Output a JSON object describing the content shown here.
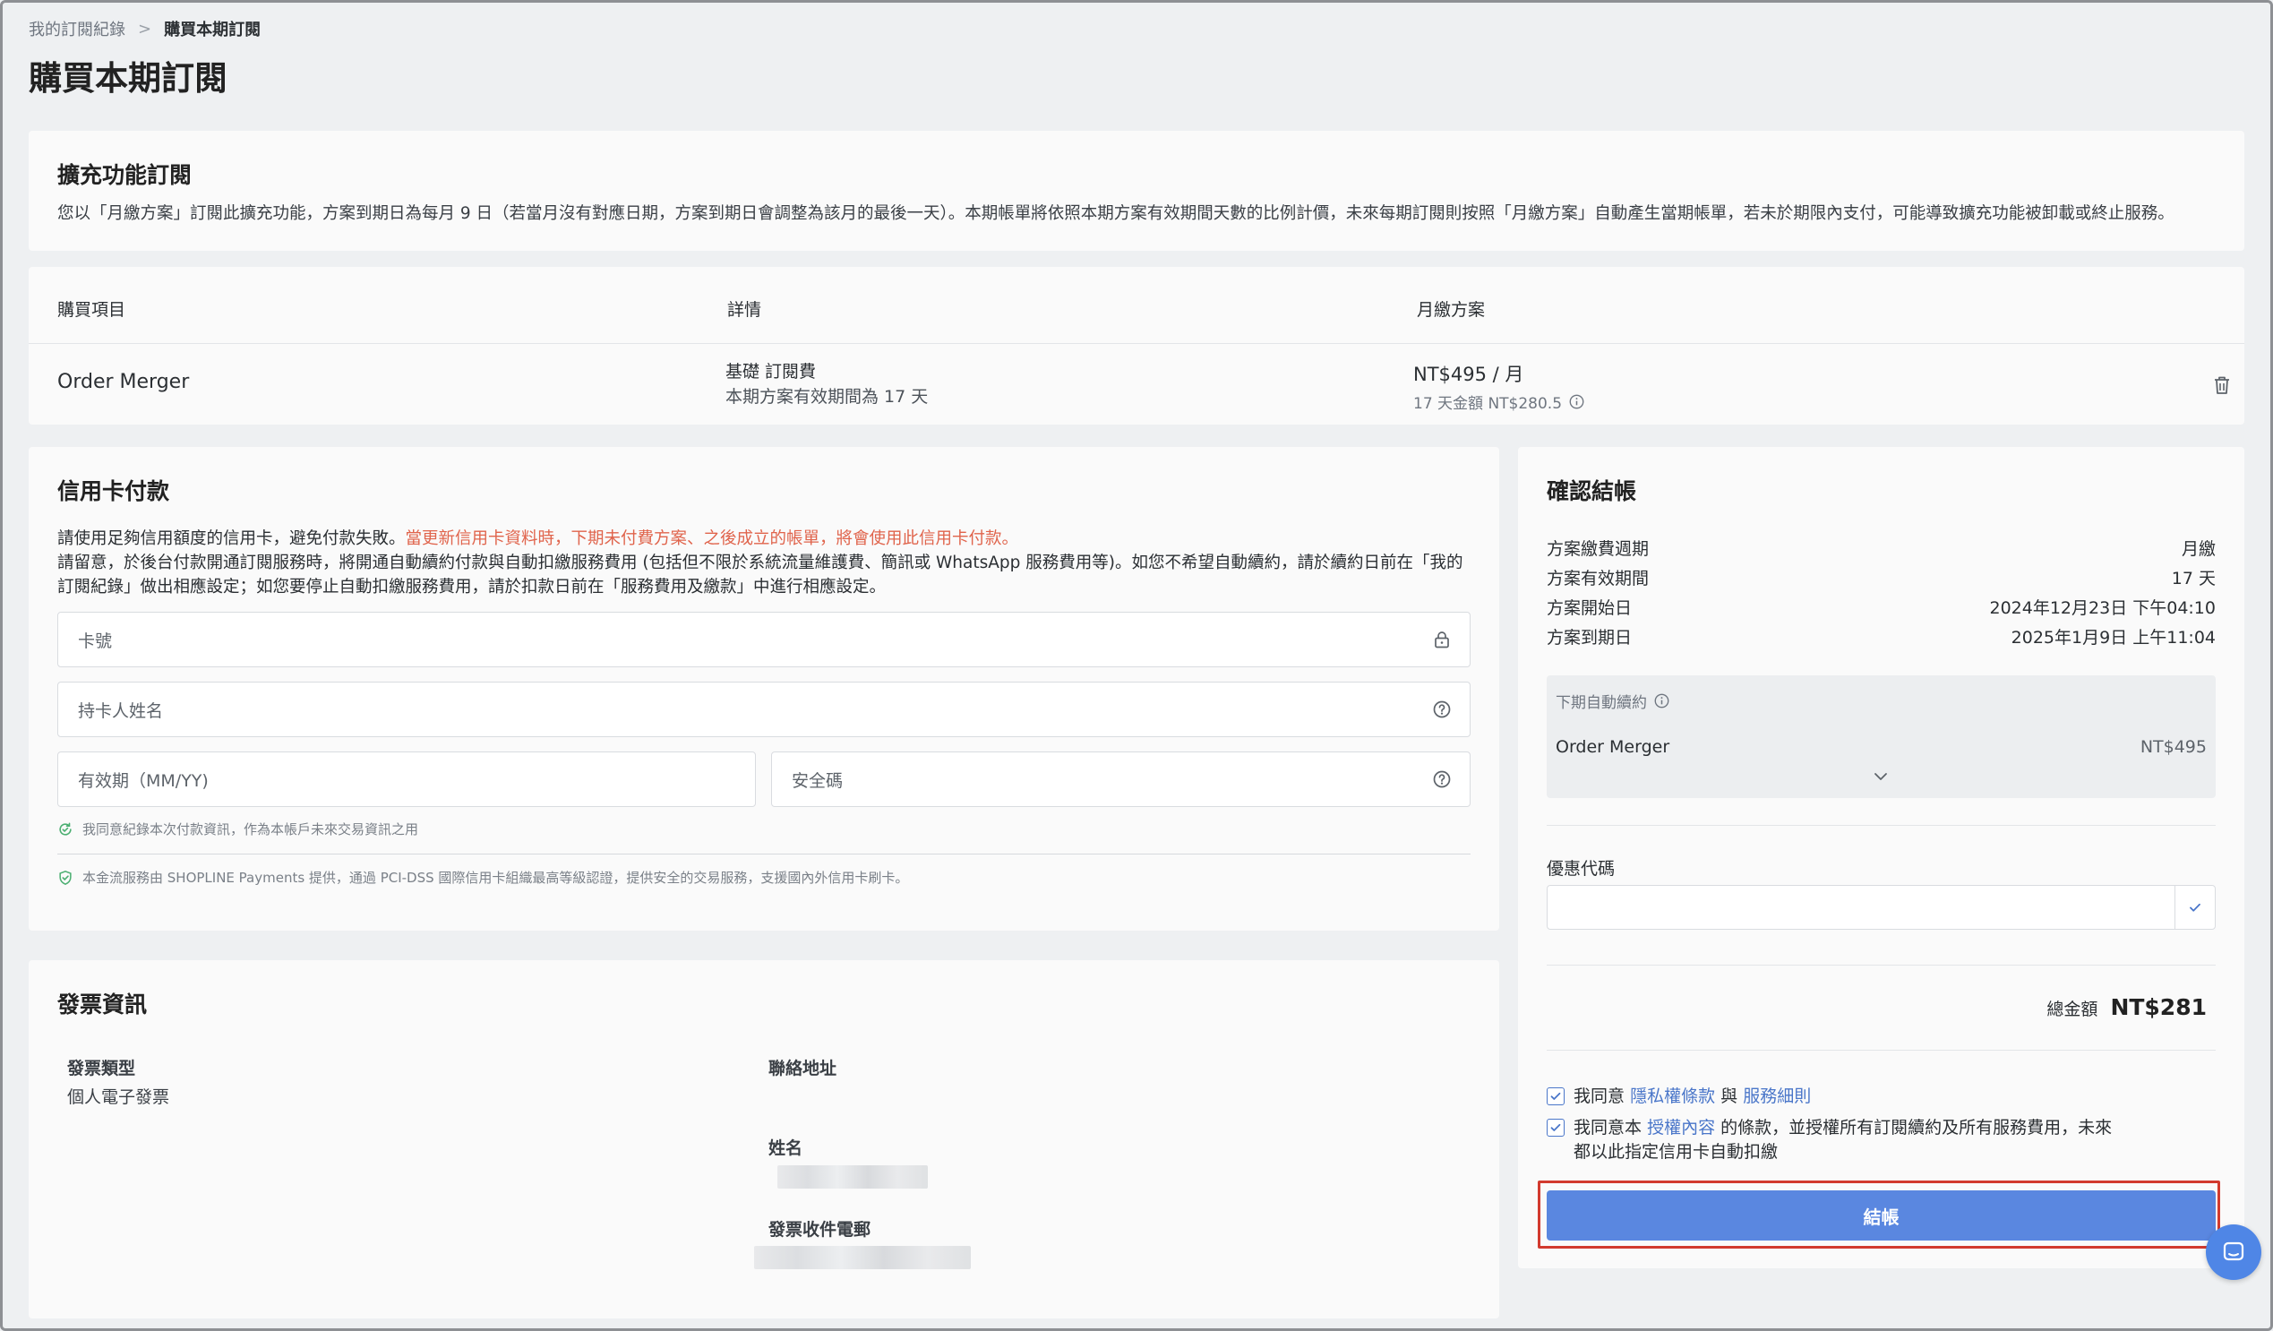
{
  "breadcrumb": {
    "parent": "我的訂閱紀錄",
    "separator": ">",
    "current": "購買本期訂閱"
  },
  "page_title": "購買本期訂閱",
  "intro": {
    "title": "擴充功能訂閱",
    "text": "您以「月繳方案」訂閱此擴充功能，方案到期日為每月 9 日（若當月沒有對應日期，方案到期日會調整為該月的最後一天）。本期帳單將依照本期方案有效期間天數的比例計價，未來每期訂閱則按照「月繳方案」自動產生當期帳單，若未於期限內支付，可能導致擴充功能被卸載或終止服務。"
  },
  "order_table": {
    "headers": {
      "item": "購買項目",
      "detail": "詳情",
      "plan": "月繳方案"
    },
    "row": {
      "item": "Order Merger",
      "detail_line1": "基礎 訂閱費",
      "detail_line2": "本期方案有效期間為 17 天",
      "price": "NT$495 / 月",
      "prorated": "17 天金額 NT$280.5"
    },
    "icons": {
      "delete": "trash-icon",
      "info": "info-icon"
    }
  },
  "payment": {
    "title": "信用卡付款",
    "notice_normal": "請使用足夠信用額度的信用卡，避免付款失敗。",
    "notice_warn": "當更新信用卡資料時，下期未付費方案、之後成立的帳單，將會使用此信用卡付款。",
    "notice_line2": "請留意，於後台付款開通訂閱服務時，將開通自動續約付款與自動扣繳服務費用 (包括但不限於系統流量維護費、簡訊或 WhatsApp 服務費用等)。如您不希望自動續約，請於續約日前在「我的訂閱紀錄」做出相應設定；如您要停止自動扣繳服務費用，請於扣款日前在「服務費用及繳款」中進行相應設定。",
    "card_number_placeholder": "卡號",
    "holder_placeholder": "持卡人姓名",
    "expiry_placeholder": "有效期（MM/YY)",
    "cvc_placeholder": "安全碼",
    "save_consent": "我同意紀錄本次付款資訊，作為本帳戶未來交易資訊之用",
    "security_note": "本金流服務由 SHOPLINE Payments 提供，通過 PCI-DSS 國際信用卡組織最高等級認證，提供安全的交易服務，支援國內外信用卡刷卡。"
  },
  "invoice": {
    "title": "發票資訊",
    "type_label": "發票類型",
    "type_value": "個人電子發票",
    "address_label": "聯絡地址",
    "name_label": "姓名",
    "email_label": "發票收件電郵"
  },
  "checkout": {
    "title": "確認結帳",
    "rows": [
      {
        "label": "方案繳費週期",
        "value": "月繳"
      },
      {
        "label": "方案有效期間",
        "value": "17 天"
      },
      {
        "label": "方案開始日",
        "value": "2024年12月23日 下午04:10"
      },
      {
        "label": "方案到期日",
        "value": "2025年1月9日 上午11:04"
      }
    ],
    "renew_title": "下期自動續約",
    "renew_item": "Order Merger",
    "renew_amount": "NT$495",
    "coupon_label": "優惠代碼",
    "coupon_value": "",
    "total_label": "總金額",
    "total_value": "NT$281",
    "agree1_pre": "我同意",
    "agree1_link1": "隱私權條款",
    "agree1_mid": "與",
    "agree1_link2": "服務細則",
    "agree2_pre": "我同意本",
    "agree2_link": "授權內容",
    "agree2_post": "的條款，並授權所有訂閱續約及所有服務費用，未來",
    "agree2_line2": "都以此指定信用卡自動扣繳",
    "pay_button": "結帳"
  },
  "colors": {
    "accent": "#5a87e0",
    "link": "#4a76c9",
    "warning": "#e0644c",
    "highlight": "#d23a2e",
    "background": "#eef0f2"
  }
}
